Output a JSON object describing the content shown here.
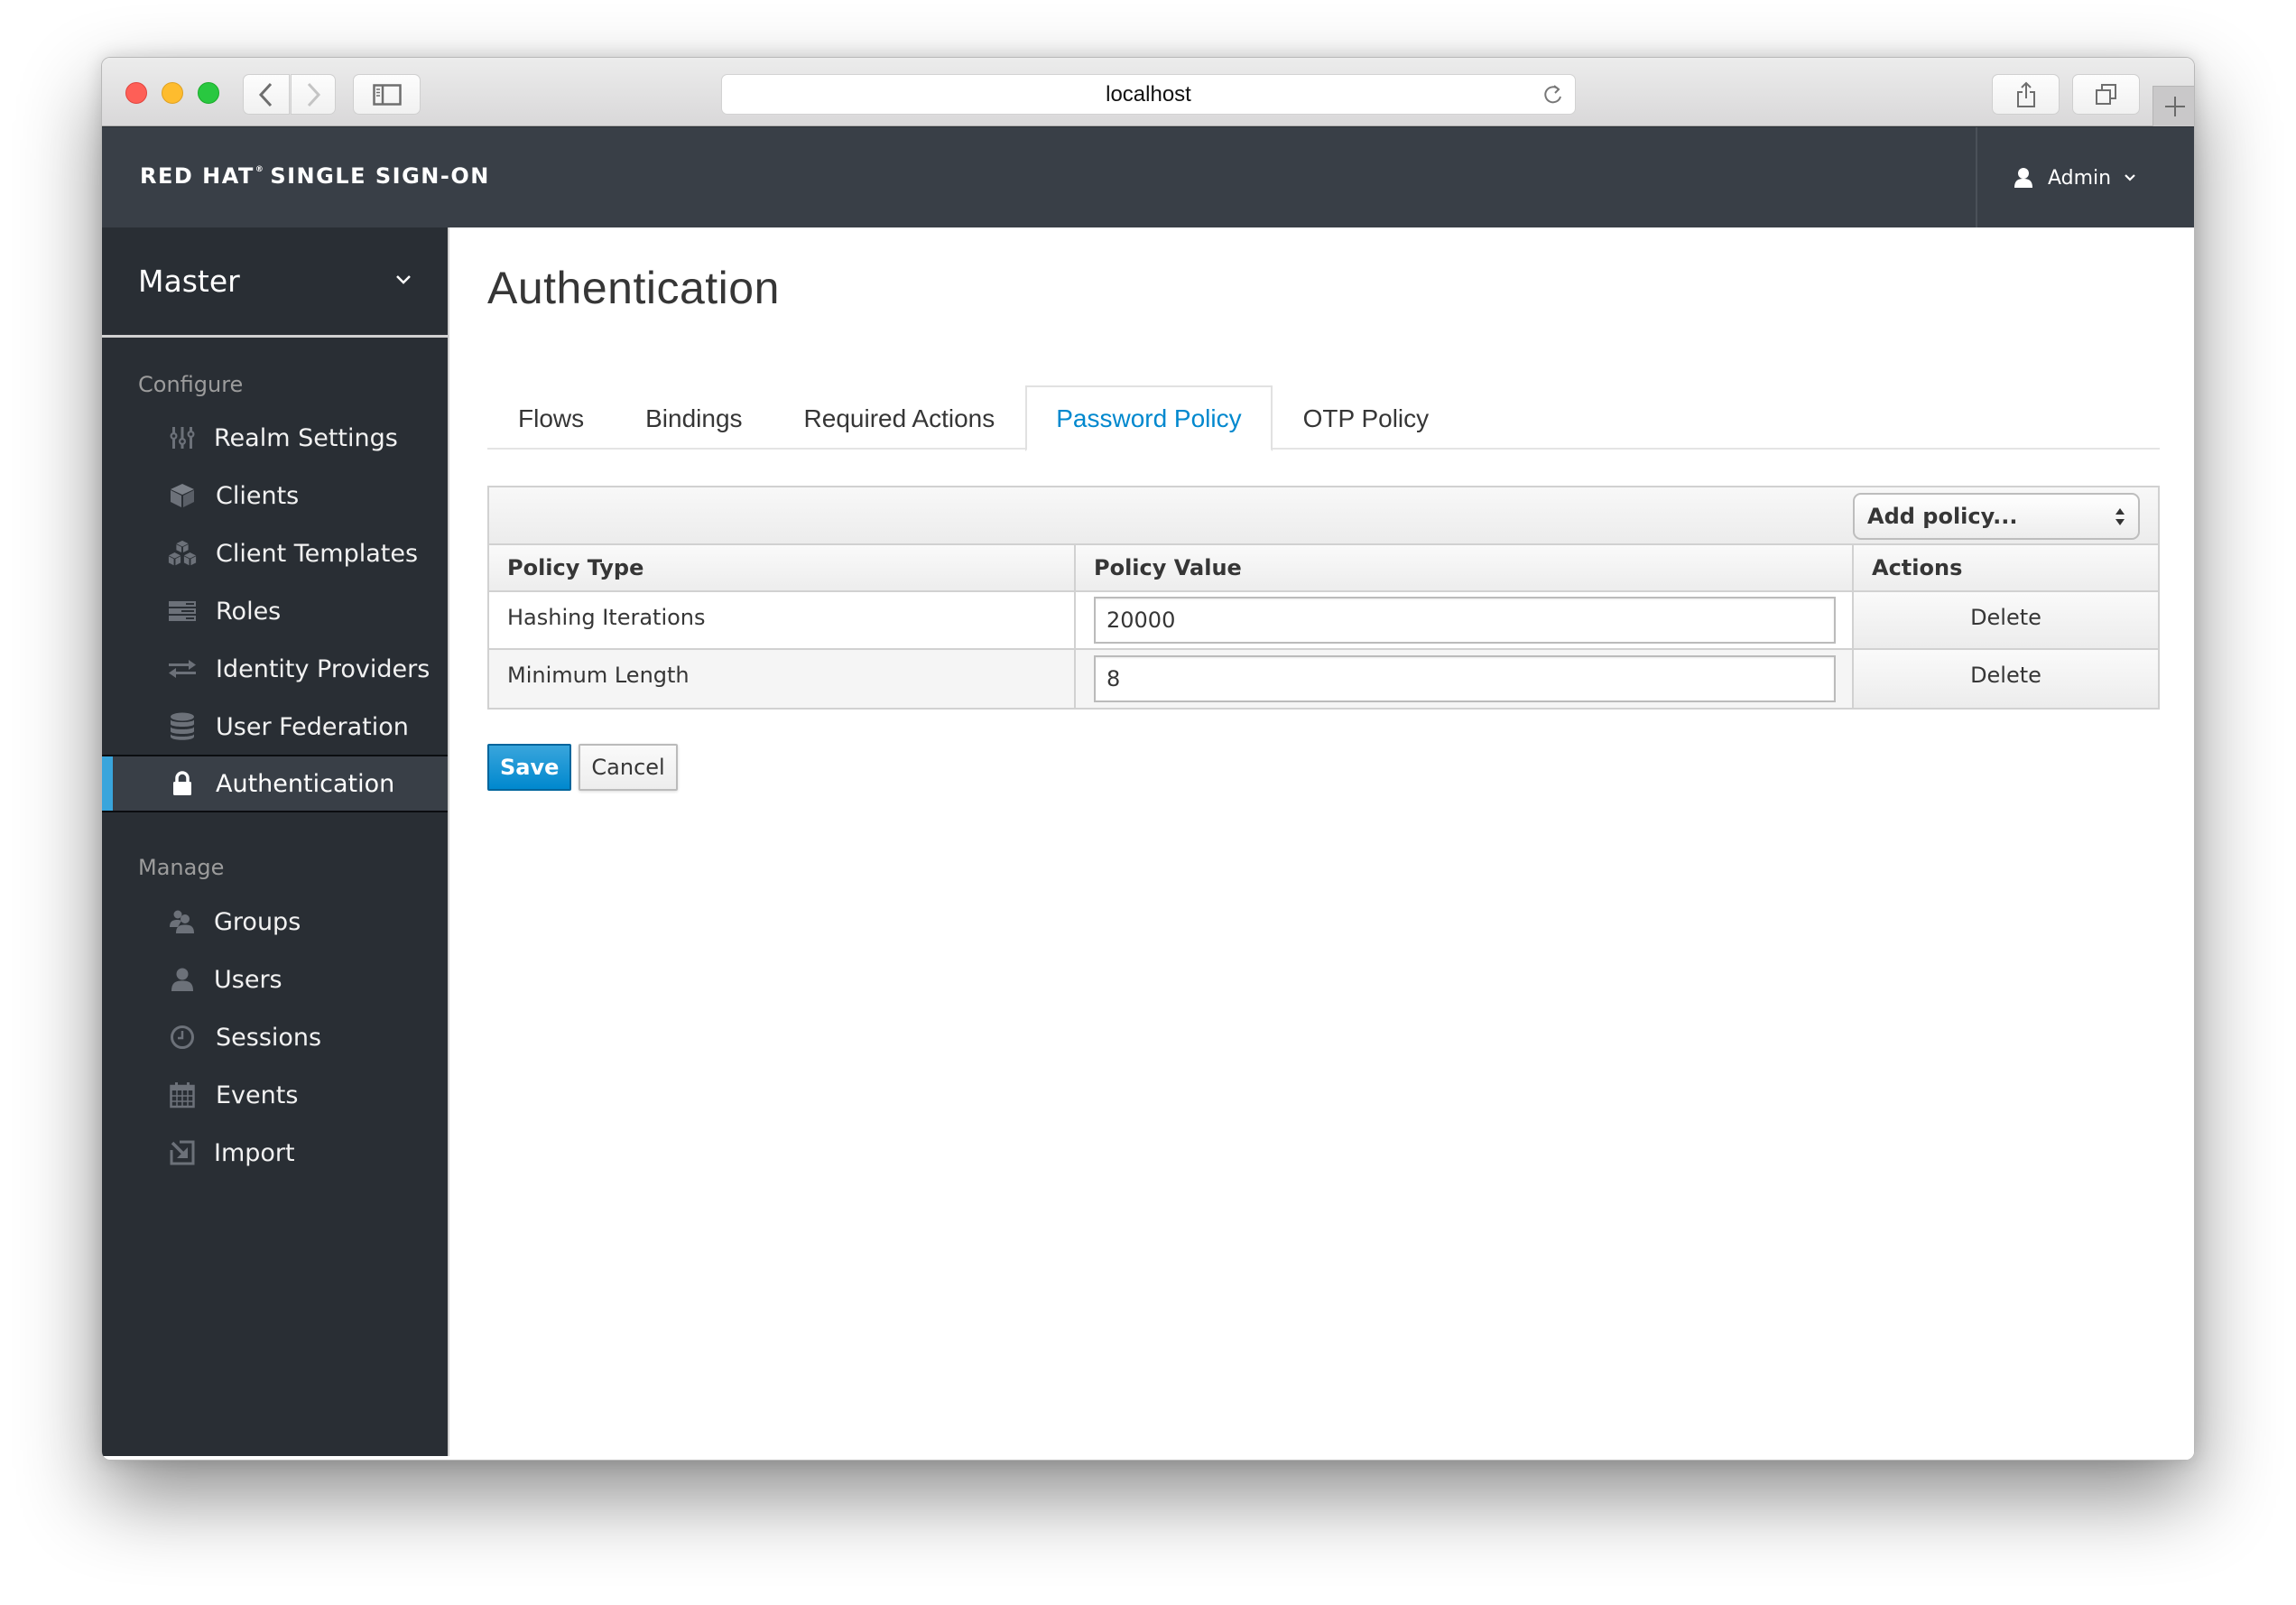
{
  "browser": {
    "url": "localhost",
    "controls": {
      "close": "close-window",
      "minimize": "minimize-window",
      "maximize": "maximize-window",
      "back": "chevron-left-icon",
      "forward": "chevron-right-icon",
      "sidebar": "sidebar-icon",
      "reload": "reload-icon",
      "share": "share-icon",
      "tabs": "tabs-overview-icon",
      "new_tab": "plus-icon"
    }
  },
  "header": {
    "brand_bold": "RED HAT",
    "brand_reg": "®",
    "brand_rest": "SINGLE SIGN-ON",
    "user": "Admin"
  },
  "sidebar": {
    "realm": "Master",
    "sections": [
      {
        "title": "Configure",
        "items": [
          {
            "label": "Realm Settings",
            "icon": "sliders-icon"
          },
          {
            "label": "Clients",
            "icon": "cube-icon"
          },
          {
            "label": "Client Templates",
            "icon": "cubes-icon"
          },
          {
            "label": "Roles",
            "icon": "roles-list-icon"
          },
          {
            "label": "Identity Providers",
            "icon": "exchange-icon"
          },
          {
            "label": "User Federation",
            "icon": "database-icon"
          },
          {
            "label": "Authentication",
            "icon": "lock-icon",
            "active": true
          }
        ]
      },
      {
        "title": "Manage",
        "items": [
          {
            "label": "Groups",
            "icon": "users-icon"
          },
          {
            "label": "Users",
            "icon": "user-icon"
          },
          {
            "label": "Sessions",
            "icon": "clock-icon"
          },
          {
            "label": "Events",
            "icon": "calendar-icon"
          },
          {
            "label": "Import",
            "icon": "import-icon"
          }
        ]
      }
    ]
  },
  "main": {
    "title": "Authentication",
    "tabs": [
      {
        "label": "Flows"
      },
      {
        "label": "Bindings"
      },
      {
        "label": "Required Actions"
      },
      {
        "label": "Password Policy",
        "active": true
      },
      {
        "label": "OTP Policy"
      }
    ],
    "add_policy_select": "Add policy...",
    "table": {
      "columns": [
        "Policy Type",
        "Policy Value",
        "Actions"
      ],
      "rows": [
        {
          "type": "Hashing Iterations",
          "value": "20000",
          "action": "Delete"
        },
        {
          "type": "Minimum Length",
          "value": "8",
          "action": "Delete"
        }
      ]
    },
    "save_label": "Save",
    "cancel_label": "Cancel"
  },
  "colors": {
    "accent": "#0088ce",
    "active_indicator": "#39a5dc",
    "header_bg": "#393f47",
    "sidebar_bg": "#292e34"
  }
}
